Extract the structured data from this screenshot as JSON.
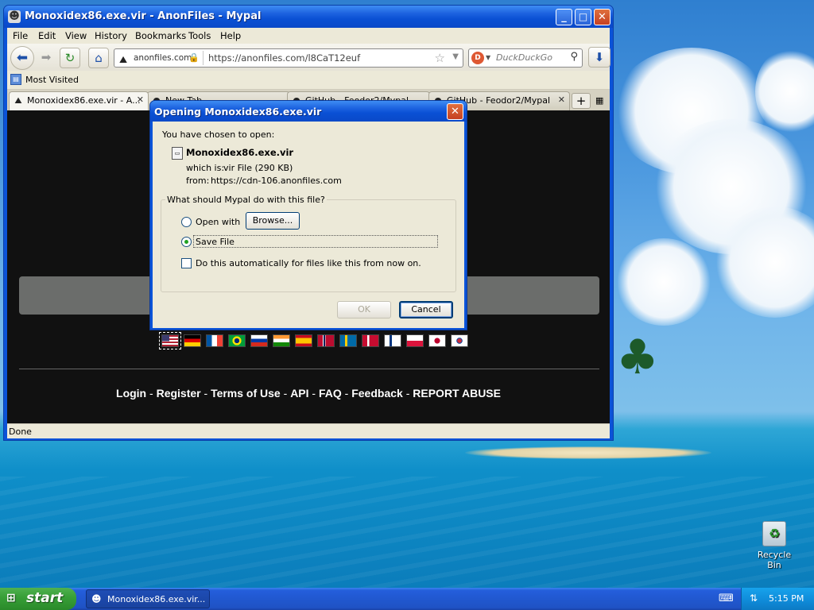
{
  "window": {
    "title": "Monoxidex86.exe.vir - AnonFiles - Mypal",
    "min": "_",
    "max": "□",
    "close": "✕"
  },
  "menu": [
    "File",
    "Edit",
    "View",
    "History",
    "Bookmarks",
    "Tools",
    "Help"
  ],
  "nav": {
    "site_identity": "anonfiles.com",
    "url": "https://anonfiles.com/l8CaT12euf",
    "search_placeholder": "DuckDuckGo"
  },
  "bookmarks": {
    "most_visited": "Most Visited"
  },
  "tabs": [
    {
      "label": "Monoxidex86.exe.vir - A...",
      "active": true
    },
    {
      "label": "New Tab",
      "active": false
    },
    {
      "label": "GitHub - Feodor2/Mypal",
      "active": false
    },
    {
      "label": "GitHub - Feodor2/Mypal",
      "active": false
    }
  ],
  "footer_links": [
    "Login",
    "Register",
    "Terms of Use",
    "API",
    "FAQ",
    "Feedback",
    "REPORT ABUSE"
  ],
  "flags": [
    "us",
    "de",
    "fr",
    "br",
    "ru",
    "in",
    "es",
    "no",
    "se",
    "dk",
    "fi",
    "pl",
    "jp",
    "kr"
  ],
  "status": "Done",
  "dialog": {
    "title": "Opening Monoxidex86.exe.vir",
    "intro": "You have chosen to open:",
    "file_name": "Monoxidex86.exe.vir",
    "which_is_label": "which is:",
    "which_is_value": "vir File (290 KB)",
    "from_label": "from:",
    "from_value": "https://cdn-106.anonfiles.com",
    "question": "What should Mypal do with this file?",
    "open_with": "Open with",
    "browse": "Browse...",
    "save_file": "Save File",
    "auto": "Do this automatically for files like this from now on.",
    "ok": "OK",
    "cancel": "Cancel",
    "selected_option": "save_file"
  },
  "taskbar": {
    "start": "start",
    "task": "Monoxidex86.exe.vir...",
    "clock": "5:15 PM"
  },
  "desktop": {
    "recycle_bin": "Recycle Bin"
  }
}
